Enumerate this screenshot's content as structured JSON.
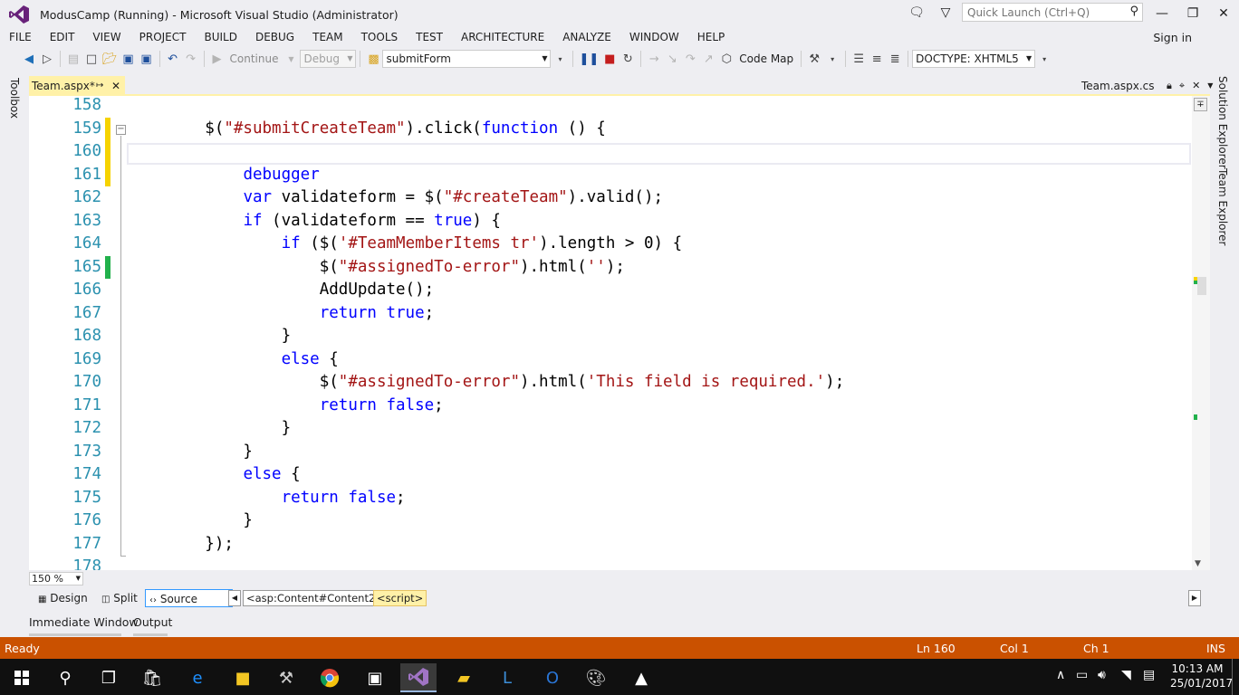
{
  "window": {
    "title": "ModusCamp (Running) - Microsoft Visual Studio (Administrator)",
    "quick_launch_placeholder": "Quick Launch (Ctrl+Q)",
    "sign_in": "Sign in"
  },
  "menu": [
    "FILE",
    "EDIT",
    "VIEW",
    "PROJECT",
    "BUILD",
    "DEBUG",
    "TEAM",
    "TOOLS",
    "TEST",
    "ARCHITECTURE",
    "ANALYZE",
    "WINDOW",
    "HELP"
  ],
  "toolbar": {
    "continue_label": "Continue",
    "config_value": "Debug",
    "function_value": "submitForm",
    "code_map_label": "Code Map",
    "doctype_value": "DOCTYPE: XHTML5"
  },
  "side_tabs": {
    "toolbox": "Toolbox",
    "solution_explorer": "Solution Explorer",
    "team_explorer": "Team Explorer"
  },
  "document_tabs": {
    "active": "Team.aspx*",
    "preview": "Team.aspx.cs"
  },
  "editor": {
    "lines": [
      {
        "n": "158",
        "code": [
          {
            "t": ""
          }
        ]
      },
      {
        "n": "159",
        "code": [
          {
            "t": "        $("
          },
          {
            "t": "\"#submitCreateTeam\"",
            "c": "str"
          },
          {
            "t": ").click("
          },
          {
            "t": "function",
            "c": "kw"
          },
          {
            "t": " () {"
          }
        ]
      },
      {
        "n": "160",
        "code": [
          {
            "t": ""
          }
        ]
      },
      {
        "n": "161",
        "code": [
          {
            "t": "            "
          },
          {
            "t": "debugger",
            "c": "kw"
          }
        ]
      },
      {
        "n": "162",
        "code": [
          {
            "t": "            "
          },
          {
            "t": "var",
            "c": "kw"
          },
          {
            "t": " validateform = $("
          },
          {
            "t": "\"#createTeam\"",
            "c": "str"
          },
          {
            "t": ").valid();"
          }
        ]
      },
      {
        "n": "163",
        "code": [
          {
            "t": "            "
          },
          {
            "t": "if",
            "c": "kw"
          },
          {
            "t": " (validateform == "
          },
          {
            "t": "true",
            "c": "kw"
          },
          {
            "t": ") {"
          }
        ]
      },
      {
        "n": "164",
        "code": [
          {
            "t": "                "
          },
          {
            "t": "if",
            "c": "kw"
          },
          {
            "t": " ($("
          },
          {
            "t": "'#TeamMemberItems tr'",
            "c": "str"
          },
          {
            "t": ").length > 0) {"
          }
        ]
      },
      {
        "n": "165",
        "code": [
          {
            "t": "                    $("
          },
          {
            "t": "\"#assignedTo-error\"",
            "c": "str"
          },
          {
            "t": ").html("
          },
          {
            "t": "''",
            "c": "str"
          },
          {
            "t": ");"
          }
        ]
      },
      {
        "n": "166",
        "code": [
          {
            "t": "                    AddUpdate();"
          }
        ]
      },
      {
        "n": "167",
        "code": [
          {
            "t": "                    "
          },
          {
            "t": "return",
            "c": "kw"
          },
          {
            "t": " "
          },
          {
            "t": "true",
            "c": "kw"
          },
          {
            "t": ";"
          }
        ]
      },
      {
        "n": "168",
        "code": [
          {
            "t": "                }"
          }
        ]
      },
      {
        "n": "169",
        "code": [
          {
            "t": "                "
          },
          {
            "t": "else",
            "c": "kw"
          },
          {
            "t": " {"
          }
        ]
      },
      {
        "n": "170",
        "code": [
          {
            "t": "                    $("
          },
          {
            "t": "\"#assignedTo-error\"",
            "c": "str"
          },
          {
            "t": ").html("
          },
          {
            "t": "'This field is required.'",
            "c": "str"
          },
          {
            "t": ");"
          }
        ]
      },
      {
        "n": "171",
        "code": [
          {
            "t": "                    "
          },
          {
            "t": "return",
            "c": "kw"
          },
          {
            "t": " "
          },
          {
            "t": "false",
            "c": "kw"
          },
          {
            "t": ";"
          }
        ]
      },
      {
        "n": "172",
        "code": [
          {
            "t": "                }"
          }
        ]
      },
      {
        "n": "173",
        "code": [
          {
            "t": "            }"
          }
        ]
      },
      {
        "n": "174",
        "code": [
          {
            "t": "            "
          },
          {
            "t": "else",
            "c": "kw"
          },
          {
            "t": " {"
          }
        ]
      },
      {
        "n": "175",
        "code": [
          {
            "t": "                "
          },
          {
            "t": "return",
            "c": "kw"
          },
          {
            "t": " "
          },
          {
            "t": "false",
            "c": "kw"
          },
          {
            "t": ";"
          }
        ]
      },
      {
        "n": "176",
        "code": [
          {
            "t": "            }"
          }
        ]
      },
      {
        "n": "177",
        "code": [
          {
            "t": "        });"
          }
        ]
      },
      {
        "n": "178",
        "code": [
          {
            "t": ""
          }
        ]
      }
    ],
    "colors": {
      "modified_unsaved": "#f6d300",
      "modified_saved": "#22b14c",
      "keyword": "#0000ff",
      "string": "#a31515",
      "line_number": "#2b91af"
    }
  },
  "zoom": "150 %",
  "view_bar": {
    "design": "Design",
    "split": "Split",
    "source": "Source",
    "crumbs": [
      "<asp:Content#Content2>",
      "<script>"
    ]
  },
  "panel_tabs": [
    "Immediate Window",
    "Output"
  ],
  "status": {
    "state": "Ready",
    "line": "Ln 160",
    "col": "Col 1",
    "ch": "Ch 1",
    "mode": "INS",
    "color": "#ca5100"
  },
  "taskbar": {
    "time": "10:13 AM",
    "date": "25/01/2017"
  }
}
